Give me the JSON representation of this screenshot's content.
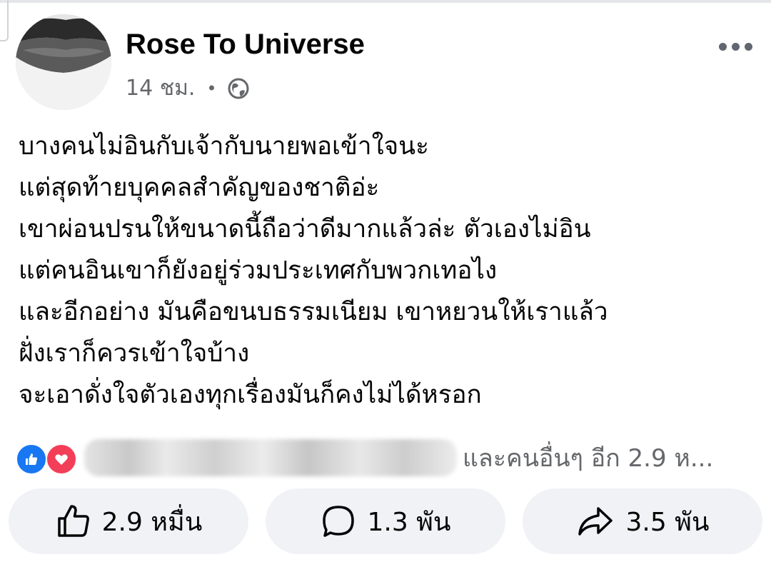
{
  "post": {
    "author": "Rose To Universe",
    "time": "14 ชม.",
    "separator": "•",
    "audience_icon": "globe-icon",
    "more_icon": "more-options-icon",
    "lines": [
      "บางคนไม่อินกับเจ้ากับนายพอเข้าใจนะ",
      "แต่สุดท้ายบุคคลสำคัญของชาติอ่ะ",
      "เขาผ่อนปรนให้ขนาดนี้ถือว่าดีมากแล้วล่ะ ตัวเองไม่อิน",
      "แต่คนอินเขาก็ยังอยู่ร่วมประเทศกับพวกเทอไง",
      "และอีกอย่าง มันคือขนบธรรมเนียม เขาหยวนให้เราแล้ว",
      "ฝั่งเราก็ควรเข้าใจบ้าง",
      "จะเอาดั่งใจตัวเองทุกเรื่องมันก็คงไม่ได้หรอก"
    ]
  },
  "reactions": {
    "icons": [
      "like-reaction-icon",
      "love-reaction-icon"
    ],
    "summary": "และคนอื่นๆ อีก 2.9 ห..."
  },
  "actions": {
    "like_count": "2.9 หมื่น",
    "comment_count": "1.3 พัน",
    "share_count": "3.5 พัน"
  },
  "colors": {
    "like_blue": "#1877f2",
    "love_red": "#f33e58",
    "secondary_text": "#65676b",
    "button_bg": "#f0f2f5"
  }
}
